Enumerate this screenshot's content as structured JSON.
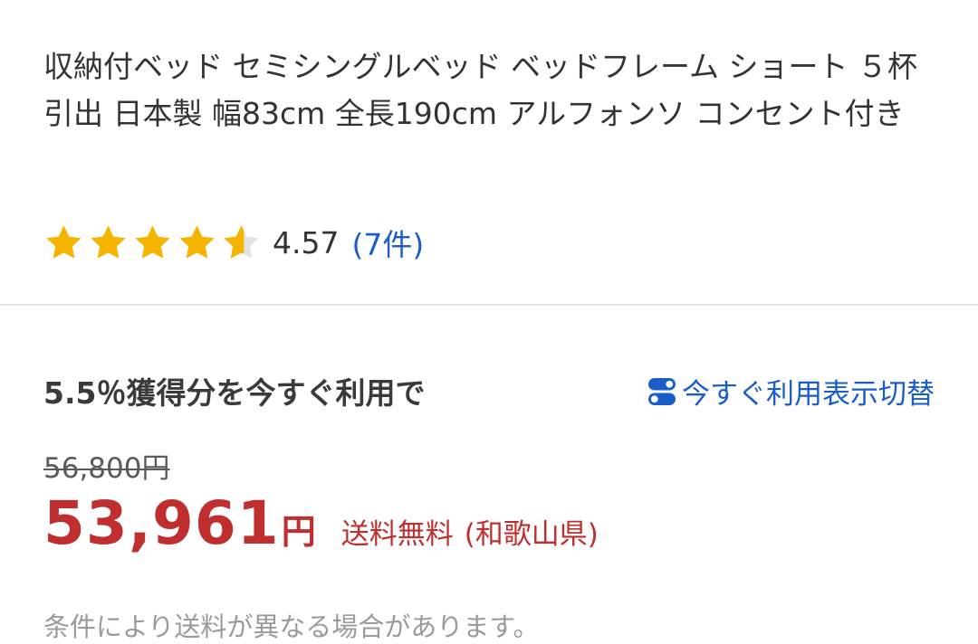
{
  "product": {
    "title": "収納付ベッド セミシングルベッド ベッドフレーム ショート ５杯引出 日本製 幅83cm 全長190cm アルフォンソ コンセント付き"
  },
  "rating": {
    "value": "4.57",
    "stars_out_of_5": 4.57,
    "review_count_label": "(7件)",
    "star_color": "#f5b400",
    "star_empty_color": "#e3e3e3"
  },
  "points": {
    "heading": "5.5％獲得分を今すぐ利用で",
    "toggle_label": "今すぐ利用表示切替",
    "toggle_icon": "toggle-switch-icon"
  },
  "price": {
    "original": "56,800円",
    "sale_amount": "53,961",
    "sale_currency": "円",
    "shipping_label": "送料無料",
    "shipping_region": "(和歌山県)",
    "note": "条件により送料が異なる場合があります。",
    "accent_color": "#bf2f2f",
    "link_color": "#1a5dc8"
  }
}
